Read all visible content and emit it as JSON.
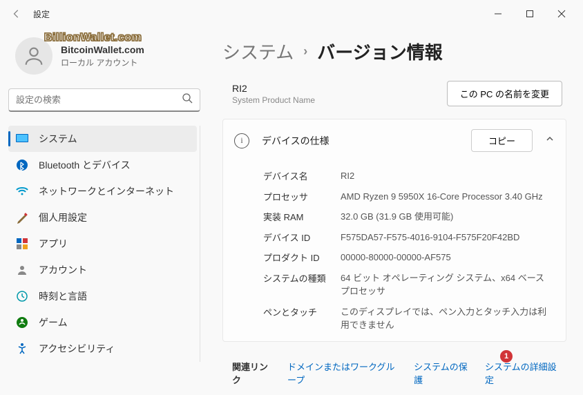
{
  "titlebar": {
    "title": "設定"
  },
  "profile": {
    "name": "BitcoinWallet.com",
    "type": "ローカル アカウント",
    "watermark": "BillionWallet.com"
  },
  "search": {
    "placeholder": "設定の検索"
  },
  "sidebar": {
    "items": [
      {
        "label": "システム",
        "icon": "system"
      },
      {
        "label": "Bluetooth とデバイス",
        "icon": "bluetooth"
      },
      {
        "label": "ネットワークとインターネット",
        "icon": "network"
      },
      {
        "label": "個人用設定",
        "icon": "personalize"
      },
      {
        "label": "アプリ",
        "icon": "apps"
      },
      {
        "label": "アカウント",
        "icon": "account"
      },
      {
        "label": "時刻と言語",
        "icon": "time"
      },
      {
        "label": "ゲーム",
        "icon": "game"
      },
      {
        "label": "アクセシビリティ",
        "icon": "accessibility"
      }
    ]
  },
  "breadcrumb": {
    "parent": "システム",
    "sep": "›",
    "current": "バージョン情報"
  },
  "device": {
    "name": "RI2",
    "sub": "System Product Name",
    "rename": "この PC の名前を変更"
  },
  "spec": {
    "title": "デバイスの仕様",
    "copy": "コピー",
    "rows": [
      {
        "label": "デバイス名",
        "val": "RI2"
      },
      {
        "label": "プロセッサ",
        "val": "AMD Ryzen 9 5950X 16-Core Processor 3.40 GHz"
      },
      {
        "label": "実装 RAM",
        "val": "32.0 GB (31.9 GB 使用可能)"
      },
      {
        "label": "デバイス ID",
        "val": "F575DA57-F575-4016-9104-F575F20F42BD"
      },
      {
        "label": "プロダクト ID",
        "val": "00000-80000-00000-AF575"
      },
      {
        "label": "システムの種類",
        "val": "64 ビット オペレーティング システム、x64 ベース プロセッサ"
      },
      {
        "label": "ペンとタッチ",
        "val": "このディスプレイでは、ペン入力とタッチ入力は利用できません"
      }
    ]
  },
  "related": {
    "label": "関連リンク",
    "links": [
      "ドメインまたはワークグループ",
      "システムの保護",
      "システムの詳細設定"
    ],
    "badge": "1"
  }
}
